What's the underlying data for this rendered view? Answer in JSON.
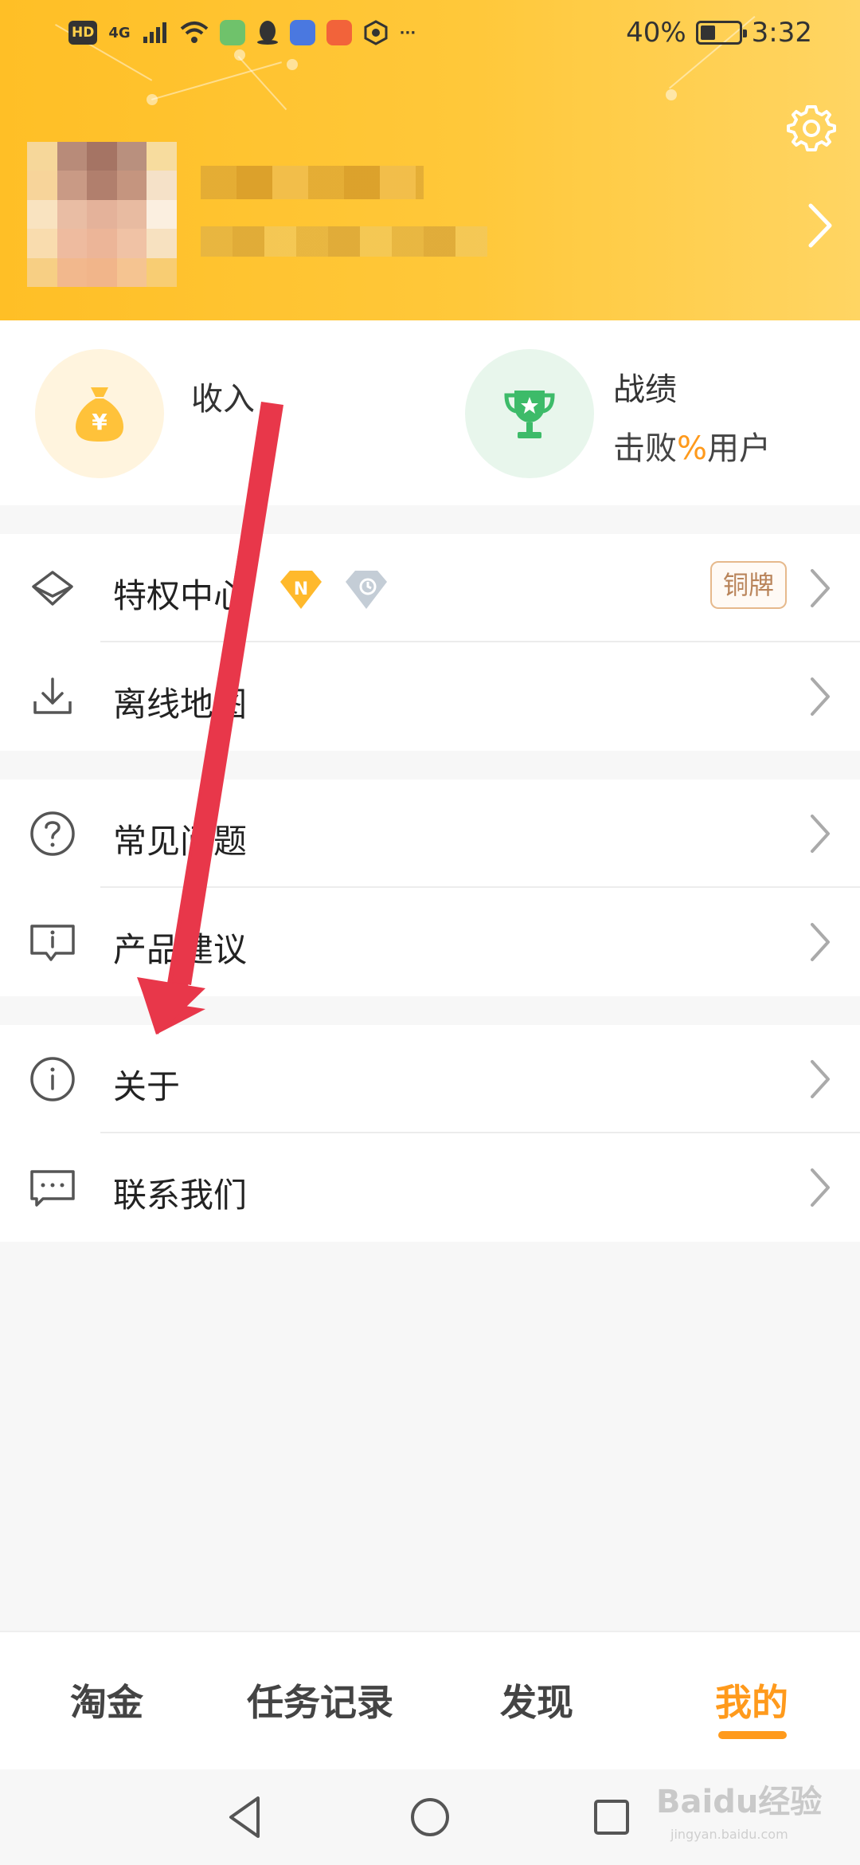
{
  "status_bar": {
    "badge_hd": "HD",
    "network": "4G",
    "battery": "40%",
    "battery_level": 0.4,
    "time": "3:32",
    "more": "···"
  },
  "header": {
    "settings_icon": "gear-icon",
    "profile_chevron_icon": "chevron-right-icon"
  },
  "stats": {
    "income_label": "收入",
    "income_icon": "money-bag-icon",
    "record_label": "战绩",
    "record_sub_before": "击败",
    "record_sub_accent": "%",
    "record_sub_after": "用户",
    "record_icon": "trophy-icon"
  },
  "menu": {
    "privilege": {
      "label": "特权中心",
      "tag": "铜牌",
      "badge_n": "N"
    },
    "offline_map": {
      "label": "离线地图"
    },
    "faq": {
      "label": "常见问题"
    },
    "feedback": {
      "label": "产品建议"
    },
    "about": {
      "label": "关于"
    },
    "contact": {
      "label": "联系我们"
    }
  },
  "tabbar": {
    "tabs": [
      {
        "label": "淘金"
      },
      {
        "label": "任务记录"
      },
      {
        "label": "发现"
      },
      {
        "label": "我的"
      }
    ],
    "active_tab": "我的"
  },
  "watermark": {
    "text": "Baidu经验",
    "url": "jingyan.baidu.com"
  },
  "colors": {
    "header_yellow": "#ffc22e",
    "accent_orange": "#ff9a1c",
    "arrow_red": "#e8374a"
  }
}
